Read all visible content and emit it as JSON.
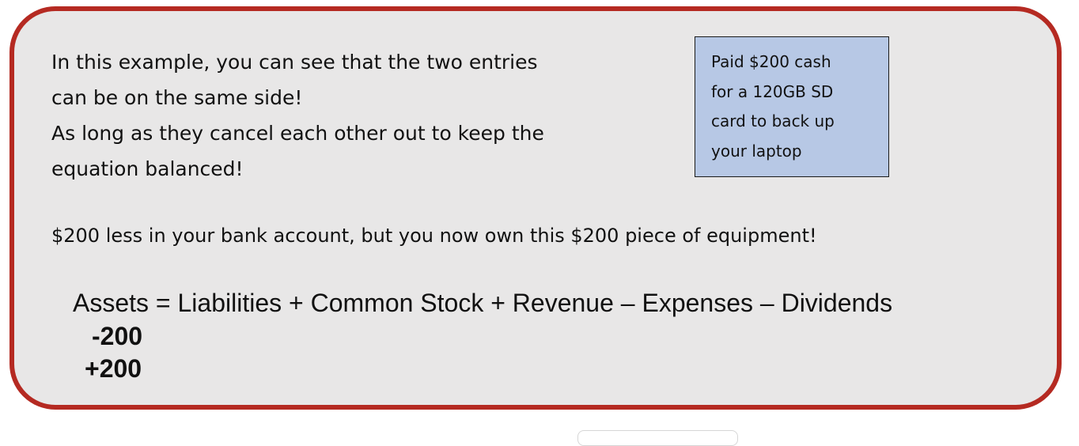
{
  "intro": {
    "lines": [
      "In this example, you can see that the two entries",
      "can be on the same side!",
      "As long as they cancel each other out to keep the",
      "equation balanced!"
    ]
  },
  "callout": {
    "lines": [
      "Paid $200 cash",
      "for a 120GB SD",
      "card to back up",
      "your laptop"
    ],
    "background_color": "#b7c8e5"
  },
  "bank_text": "$200 less in your bank account, but you now own this $200 piece of equipment!",
  "equation": {
    "text": "Assets = Liabilities + Common Stock + Revenue – Expenses – Dividends",
    "entries": [
      "-200",
      "+200"
    ]
  },
  "colors": {
    "border": "#b52a22",
    "panel_background": "#e8e7e7"
  }
}
